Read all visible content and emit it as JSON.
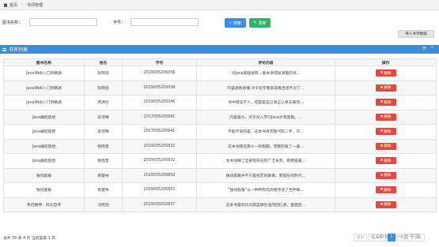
{
  "breadcrumb": {
    "home": "首页",
    "current": "书评管理"
  },
  "search": {
    "book_label": "图书名称：",
    "book_placeholder": "",
    "student_label": "学号：",
    "student_placeholder": "",
    "search_button": "搜索",
    "add_button": "更新",
    "import_button": "导入书评数据"
  },
  "panel": {
    "title": "书评列表"
  },
  "table": {
    "headers": [
      "图书名称",
      "姓名",
      "学号",
      "评论内容",
      "操作"
    ],
    "delete_label": "删除",
    "rows": [
      {
        "book": "JavaWeb入门到精通",
        "name": "张明浩",
        "id": "2019035205036",
        "comment": "对Java基础很有…基本讲得很清楚的详…"
      },
      {
        "book": "JavaWeb入门到精通",
        "name": "张明浩",
        "id": "2019035205038",
        "comment": "内容通俗易懂 对于初学者来说再合适不过了…"
      },
      {
        "book": "JavaWeb入门到精通",
        "name": "周清伦",
        "id": "2019035205046",
        "comment": "书中错误不少，但是是自己真正认真去看的…"
      },
      {
        "book": "Java编程思想",
        "name": "安佳琳",
        "id": "2017035205841",
        "comment": "内容强大，对于深入学习Java大有帮助。…"
      },
      {
        "book": "Java编程思想",
        "name": "安佳琳",
        "id": "2017035205841",
        "comment": "不能不说的是，这本书真完整代码二字，内…"
      },
      {
        "book": "Java编程思想",
        "name": "杨雨萱",
        "id": "2019035205832",
        "comment": "这本书我在用十一的假期，完整的看了一遍…"
      },
      {
        "book": "Java编程思想",
        "name": "杨雨萱",
        "id": "2019035205832",
        "comment": "本书详细了全部程序员的广泛背景，即便是最…"
      },
      {
        "book": "独伐鹿角",
        "name": "龚楚林",
        "id": "2019035205852",
        "comment": "独伐鹿角并不只是指艺的故事，而是任何时代…"
      },
      {
        "book": "独伐鹿角",
        "name": "龚楚林",
        "id": "2019035205852",
        "comment": "“独伐鹿角”以一种特有的风格传递了世界每…"
      },
      {
        "book": "呆巴精神：科比自传",
        "name": "冯宪田",
        "id": "2019035502837",
        "comment": "这本书是科比对其篮球生涯的回忆录，里面包…"
      }
    ]
  },
  "footer": {
    "summary": "总共 35 条 4 页   当前是第 1 页"
  },
  "pagination": {
    "items": [
      "首页",
      "上一页",
      "1",
      "2",
      "下一页"
    ]
  },
  "watermark": "CSDN @一点干货"
}
